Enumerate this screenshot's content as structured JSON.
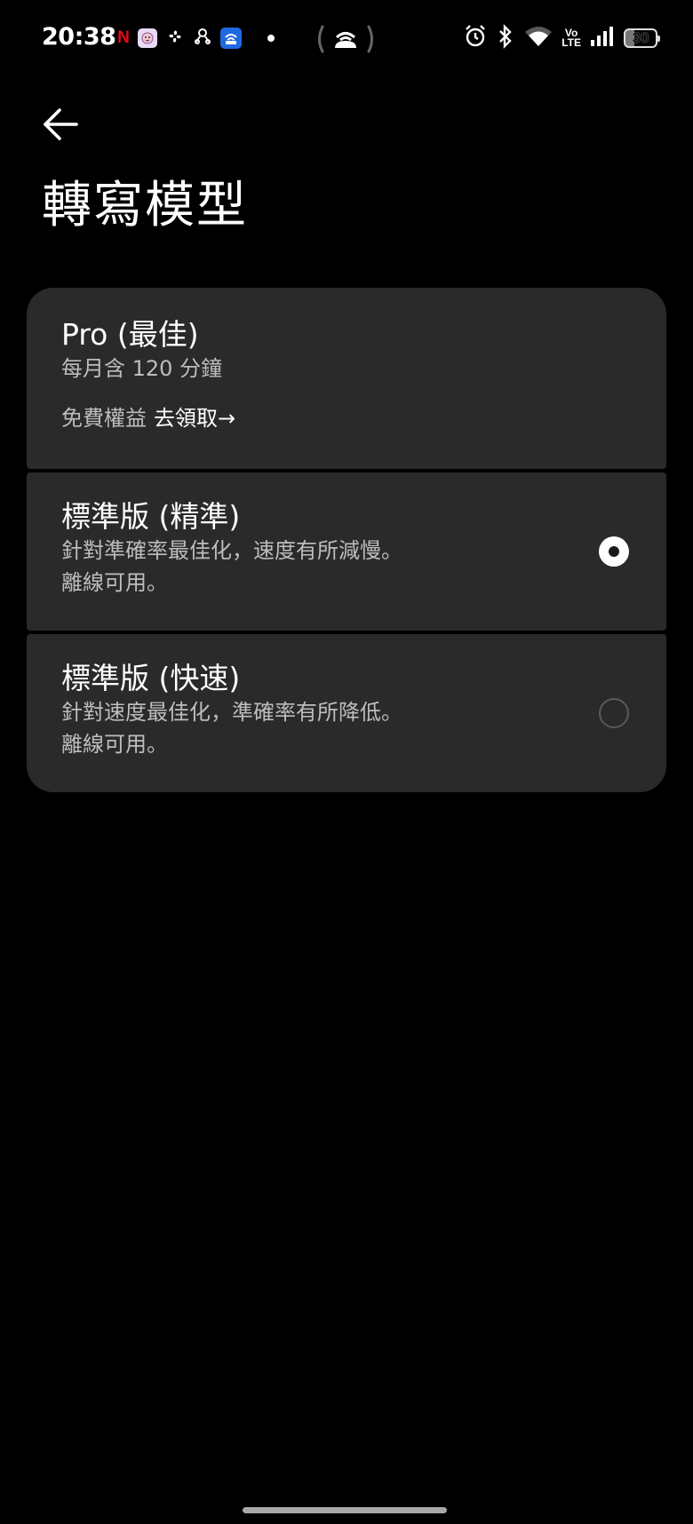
{
  "status_bar": {
    "time": "20:38",
    "netflix_glyph": "N",
    "volte_top": "Vo",
    "volte_bottom": "LTE",
    "battery_level": "30"
  },
  "header": {
    "back_icon": "arrow-left-icon",
    "title": "轉寫模型"
  },
  "options": [
    {
      "title": "Pro (最佳)",
      "description": "每月含 120 分鐘",
      "promo_label": "免費權益",
      "promo_link": "去領取→"
    },
    {
      "title": "標準版 (精準)",
      "description_line1": "針對準確率最佳化，速度有所減慢。",
      "description_line2": "離線可用。",
      "selected": true
    },
    {
      "title": "標準版 (快速)",
      "description_line1": "針對速度最佳化，準確率有所降低。",
      "description_line2": "離線可用。",
      "selected": false
    }
  ],
  "colors": {
    "background": "#000000",
    "card": "#2a2a2a",
    "secondary_text": "#bdbdbd"
  }
}
